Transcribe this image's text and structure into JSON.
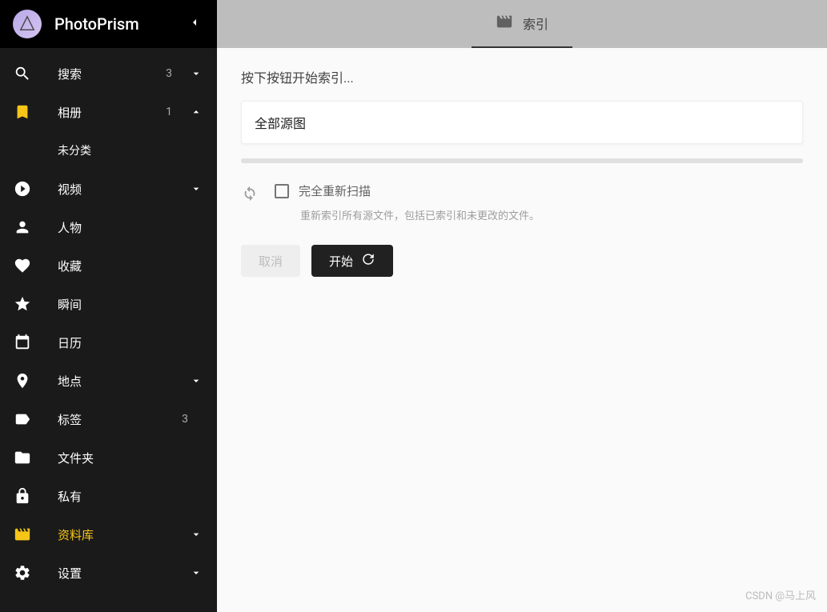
{
  "app": {
    "title": "PhotoPrism"
  },
  "sidebar": {
    "items": [
      {
        "label": "搜索",
        "count": "3"
      },
      {
        "label": "相册",
        "count": "1"
      },
      {
        "label": "视频"
      },
      {
        "label": "人物"
      },
      {
        "label": "收藏"
      },
      {
        "label": "瞬间"
      },
      {
        "label": "日历"
      },
      {
        "label": "地点"
      },
      {
        "label": "标签",
        "count": "3"
      },
      {
        "label": "文件夹"
      },
      {
        "label": "私有"
      },
      {
        "label": "资料库"
      },
      {
        "label": "设置"
      }
    ],
    "subitems": {
      "uncategorized": "未分类"
    }
  },
  "topbar": {
    "tab_index": "索引"
  },
  "content": {
    "hint": "按下按钮开始索引...",
    "select_value": "全部源图",
    "rescan_label": "完全重新扫描",
    "rescan_desc": "重新索引所有源文件，包括已索引和未更改的文件。",
    "cancel_label": "取消",
    "start_label": "开始"
  },
  "watermark": "CSDN @马上风"
}
